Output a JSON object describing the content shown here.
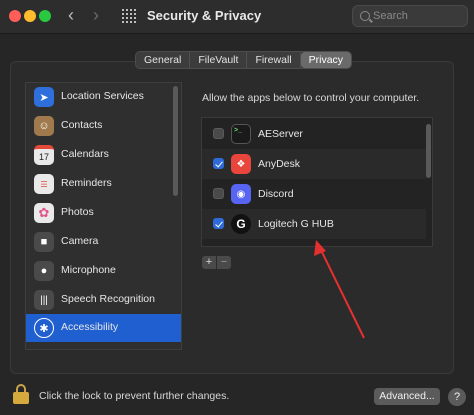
{
  "window": {
    "title": "Security & Privacy"
  },
  "search": {
    "placeholder": "Search"
  },
  "tabs": [
    {
      "label": "General",
      "active": false
    },
    {
      "label": "FileVault",
      "active": false
    },
    {
      "label": "Firewall",
      "active": false
    },
    {
      "label": "Privacy",
      "active": true
    }
  ],
  "categories": [
    {
      "label": "Location Services",
      "icon": "location-arrow-icon",
      "color": "#2f6fdc"
    },
    {
      "label": "Contacts",
      "icon": "contacts-book-icon",
      "color": "#a07a4c"
    },
    {
      "label": "Calendars",
      "icon": "calendar-icon",
      "color": "#e9e9e9"
    },
    {
      "label": "Reminders",
      "icon": "reminders-list-icon",
      "color": "#e9e9e9"
    },
    {
      "label": "Photos",
      "icon": "photos-flower-icon",
      "color": "#e9e9e9"
    },
    {
      "label": "Camera",
      "icon": "camera-icon",
      "color": "#4a4a4a"
    },
    {
      "label": "Microphone",
      "icon": "microphone-icon",
      "color": "#4a4a4a"
    },
    {
      "label": "Speech Recognition",
      "icon": "speech-waveform-icon",
      "color": "#4a4a4a"
    },
    {
      "label": "Accessibility",
      "icon": "accessibility-person-icon",
      "color": "#1f5fd0",
      "selected": true
    }
  ],
  "privacy": {
    "description": "Allow the apps below to control your computer.",
    "apps": [
      {
        "name": "AEServer",
        "checked": false,
        "icon": "terminal-icon",
        "color": "#1a1a1a"
      },
      {
        "name": "AnyDesk",
        "checked": true,
        "icon": "anydesk-icon",
        "color": "#e8453c"
      },
      {
        "name": "Discord",
        "checked": false,
        "icon": "discord-icon",
        "color": "#5865f2"
      },
      {
        "name": "Logitech G HUB",
        "checked": true,
        "icon": "logitech-g-icon",
        "color": "#111111"
      }
    ],
    "add_label": "+",
    "remove_label": "−"
  },
  "footer": {
    "lock_text": "Click the lock to prevent further changes.",
    "advanced_label": "Advanced...",
    "help_label": "?"
  },
  "colors": {
    "accent": "#1f5fd0",
    "annotation_arrow": "#e53030"
  }
}
